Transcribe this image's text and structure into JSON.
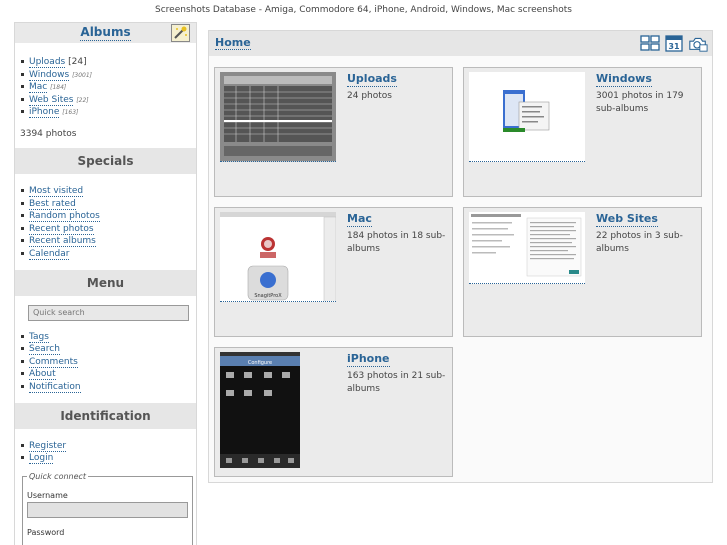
{
  "site_title": "Screenshots Database - Amiga, Commodore 64, iPhone, Android, Windows, Mac screenshots",
  "sidebar": {
    "albums_heading": "Albums",
    "albums": [
      {
        "label": "Uploads",
        "count": "[24]",
        "count_style": "normal"
      },
      {
        "label": "Windows",
        "count": "[3001]",
        "count_style": "italic"
      },
      {
        "label": "Mac",
        "count": "[184]",
        "count_style": "italic"
      },
      {
        "label": "Web Sites",
        "count": "[22]",
        "count_style": "italic"
      },
      {
        "label": "iPhone",
        "count": "[163]",
        "count_style": "italic"
      }
    ],
    "total_photos": "3394 photos",
    "specials_heading": "Specials",
    "specials": [
      "Most visited",
      "Best rated",
      "Random photos",
      "Recent photos",
      "Recent albums",
      "Calendar"
    ],
    "menu_heading": "Menu",
    "quick_search": "Quick search",
    "menu_items": [
      "Tags",
      "Search",
      "Comments",
      "About",
      "Notification"
    ],
    "identification_heading": "Identification",
    "identification_items": [
      "Register",
      "Login"
    ],
    "quick_connect": {
      "legend": "Quick connect",
      "username_label": "Username",
      "password_label": "Password"
    }
  },
  "main": {
    "title": "Home",
    "header_icons": [
      "thumbnails-view-icon",
      "calendar-icon",
      "slideshow-icon"
    ],
    "calendar_day": "31",
    "categories": [
      {
        "name": "Uploads",
        "desc": "24 photos"
      },
      {
        "name": "Windows",
        "desc": "3001 photos in 179 sub-albums"
      },
      {
        "name": "Mac",
        "desc": "184 photos in 18 sub-albums"
      },
      {
        "name": "Web Sites",
        "desc": "22 photos in 3 sub-albums"
      },
      {
        "name": "iPhone",
        "desc": "163 photos in 21 sub-albums"
      }
    ],
    "mac_thumb_caption": "SnagitProX",
    "iphone_thumb_title": "Configure"
  },
  "colors": {
    "link": "#2a6496",
    "header_bg": "#e6e6e6",
    "cell_bg": "#ebebeb"
  }
}
